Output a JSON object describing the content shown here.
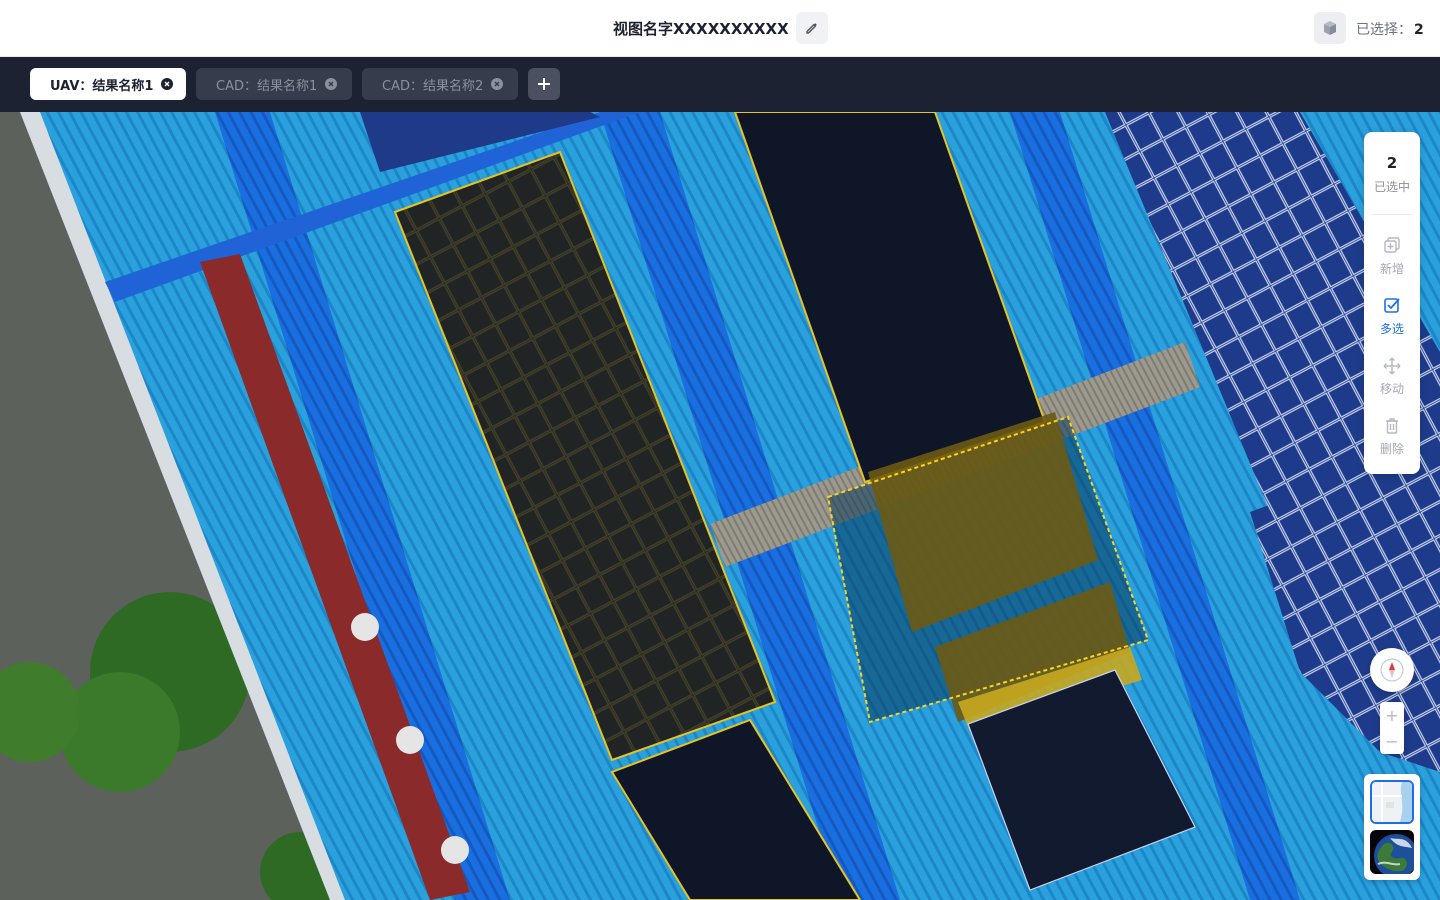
{
  "header": {
    "view_name": "视图名字XXXXXXXXXX",
    "edit_icon": "pencil-icon",
    "cube_icon": "cube-icon",
    "selected_label": "已选择：",
    "selected_count": "2"
  },
  "tabs": [
    {
      "label": "UAV：结果名称1",
      "active": true
    },
    {
      "label": "CAD：结果名称1",
      "active": false
    },
    {
      "label": "CAD：结果名称2",
      "active": false
    }
  ],
  "add_tab_icon": "plus-icon",
  "toolbar": {
    "count": "2",
    "count_label": "已选中",
    "items": [
      {
        "label": "新增",
        "icon": "add-layer-icon",
        "active": false
      },
      {
        "label": "多选",
        "icon": "multi-select-icon",
        "active": true
      },
      {
        "label": "移动",
        "icon": "move-icon",
        "active": false
      },
      {
        "label": "删除",
        "icon": "trash-icon",
        "active": false
      }
    ]
  },
  "zoom": {
    "in": "+",
    "out": "−"
  },
  "colors": {
    "accent": "#1f6ee8",
    "highlight": "#e6c320",
    "tabbar_bg": "#1c2232",
    "roof_blue": "#1f95d5"
  }
}
